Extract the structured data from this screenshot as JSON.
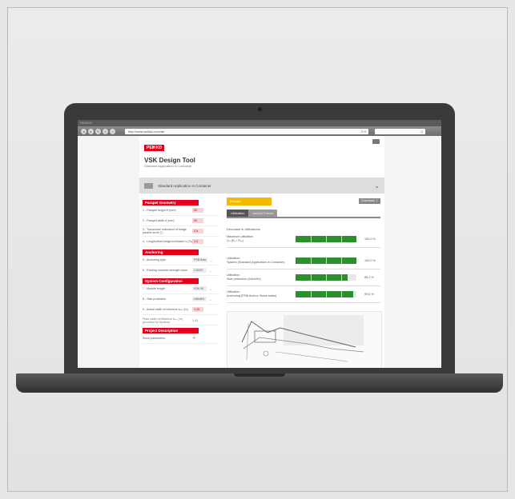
{
  "browser": {
    "title": "PEIKKO",
    "url": "http://www.peikko.com/de",
    "controls": "⊘ ▾",
    "search": "Q"
  },
  "app": {
    "logo": "PEIKKO",
    "title": "VSK Design Tool",
    "subtitle": "Standard Application in Container",
    "app_bar": "Standard Application in Container"
  },
  "left": {
    "sections": [
      {
        "title": "Parapet Geometry",
        "rows": [
          {
            "label": "1 - Parapet height H (mm)",
            "value": "90"
          },
          {
            "label": "2 - Parapet width d (mm)",
            "value": "20"
          },
          {
            "label": "3 - Transverse inclination of bridge parallel at e0 (°)",
            "value": "2.5"
          },
          {
            "label": "4 - Longitudinal bridge inclination v (%)",
            "value": "1.0"
          }
        ]
      },
      {
        "title": "Anchoring",
        "rows": [
          {
            "label": "5 - Anchoring type",
            "value": "PSB Bow"
          },
          {
            "label": "6 - Existing concrete strength class",
            "value": "C30/37"
          }
        ]
      },
      {
        "title": "System Configuration",
        "rows": [
          {
            "label": "7 - Module length",
            "value": "VSK 60"
          },
          {
            "label": "8 - Side protection",
            "value": "H4b/W4"
          },
          {
            "label": "9 - Actual width of influence bₑₓₜ (m)",
            "value": "1.25"
          }
        ]
      }
    ],
    "plain_note": "Plate width of influence bₑₓₜ (m) (provided by System)",
    "plain_value": "1.43",
    "project_section": "Project Description",
    "project_row": "Show parameters",
    "plus": "+"
  },
  "right": {
    "results_label": "Results",
    "download_label": "Download ⇩",
    "tabs": [
      "Utilization",
      "Anchor Forces"
    ],
    "section_heading": "Decrease in Utilizations",
    "rows": [
      {
        "label": "Maximum utilization",
        "sub": "Uᵤᵢ (Eₐ / Rₐᵤ)",
        "value": 1.0,
        "pct": "100.0 %"
      },
      {
        "label": "Utilization",
        "sub": "System (Standard Application in Container)",
        "value": 1.0,
        "pct": "100.0 %"
      },
      {
        "label": "Utilization",
        "sub": "Side protection (H4b/W4)",
        "value": 0.85,
        "pct": "85.2 %"
      },
      {
        "label": "Utilization",
        "sub": "Anchoring (PSB Anchor Stone slabs)",
        "value": 0.95,
        "pct": "99.6 %"
      }
    ]
  },
  "colors": {
    "brand": "#e2001a",
    "results": "#f7b800",
    "bar": "#2b8f2b"
  }
}
